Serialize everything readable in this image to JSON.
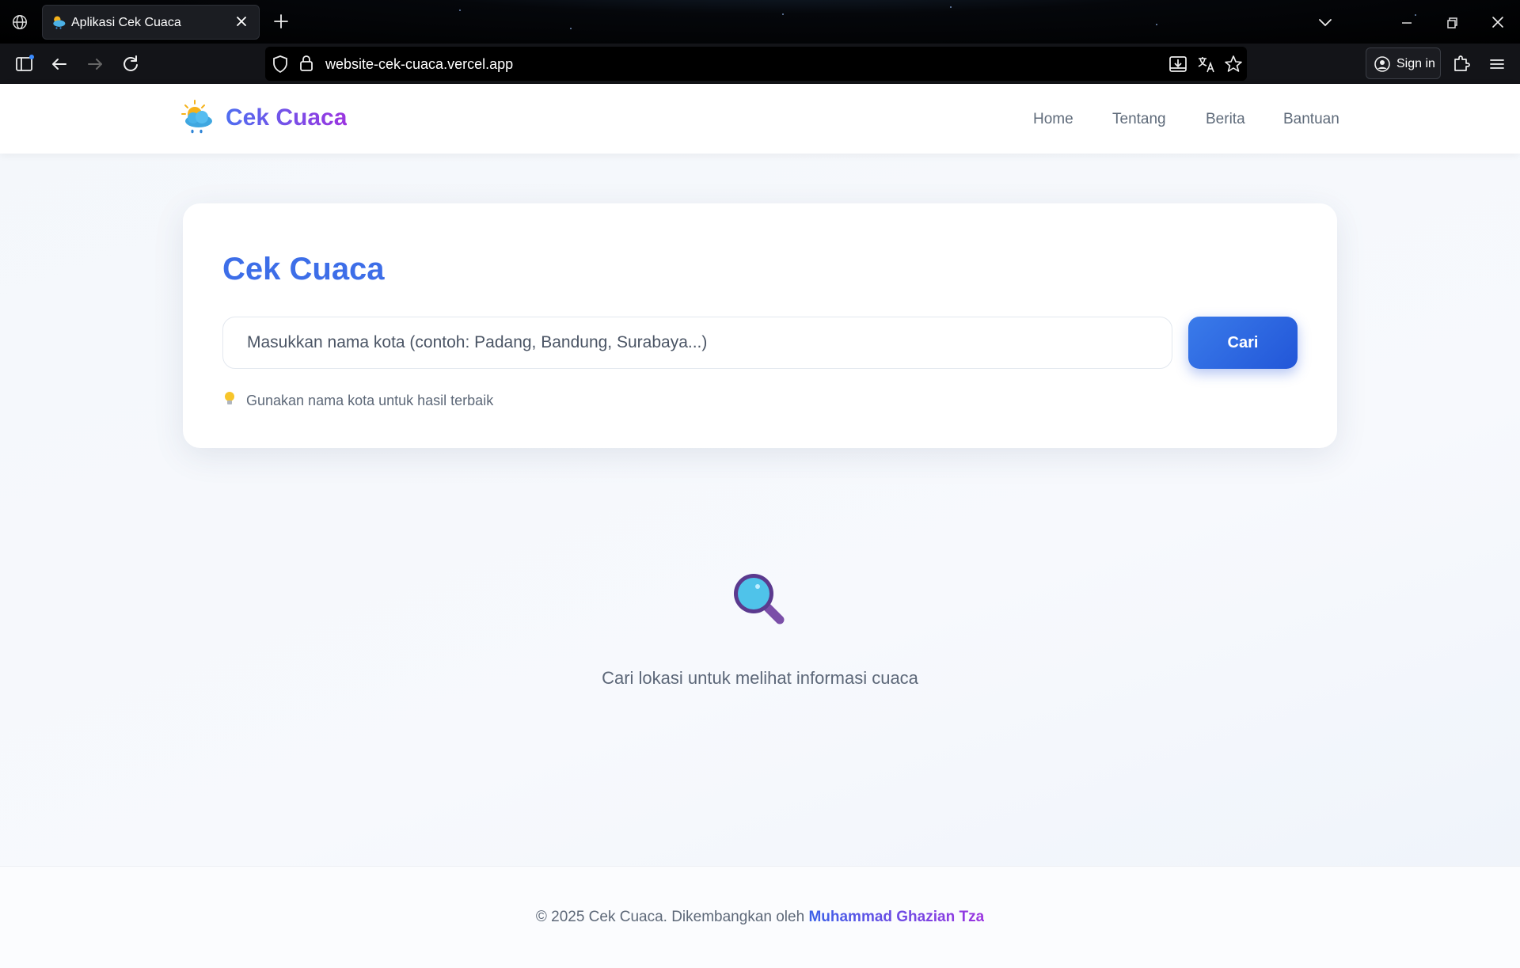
{
  "browser": {
    "tab_title": "Aplikasi Cek Cuaca",
    "url": "website-cek-cuaca.vercel.app",
    "signin_label": "Sign in"
  },
  "site": {
    "brand": "Cek Cuaca",
    "nav": [
      "Home",
      "Tentang",
      "Berita",
      "Bantuan"
    ]
  },
  "search_card": {
    "title": "Cek Cuaca",
    "placeholder": "Masukkan nama kota (contoh: Padang, Bandung, Surabaya...)",
    "button_label": "Cari",
    "hint": "Gunakan nama kota untuk hasil terbaik"
  },
  "empty_state": {
    "message": "Cari lokasi untuk melihat informasi cuaca"
  },
  "footer": {
    "prefix": "© 2025 Cek Cuaca. Dikembangkan oleh",
    "author": "Muhammad Ghazian Tza"
  },
  "colors": {
    "accent_blue": "#3d6ee8",
    "brand_purple": "#9b34e0",
    "button_blue": "#2256d8"
  }
}
